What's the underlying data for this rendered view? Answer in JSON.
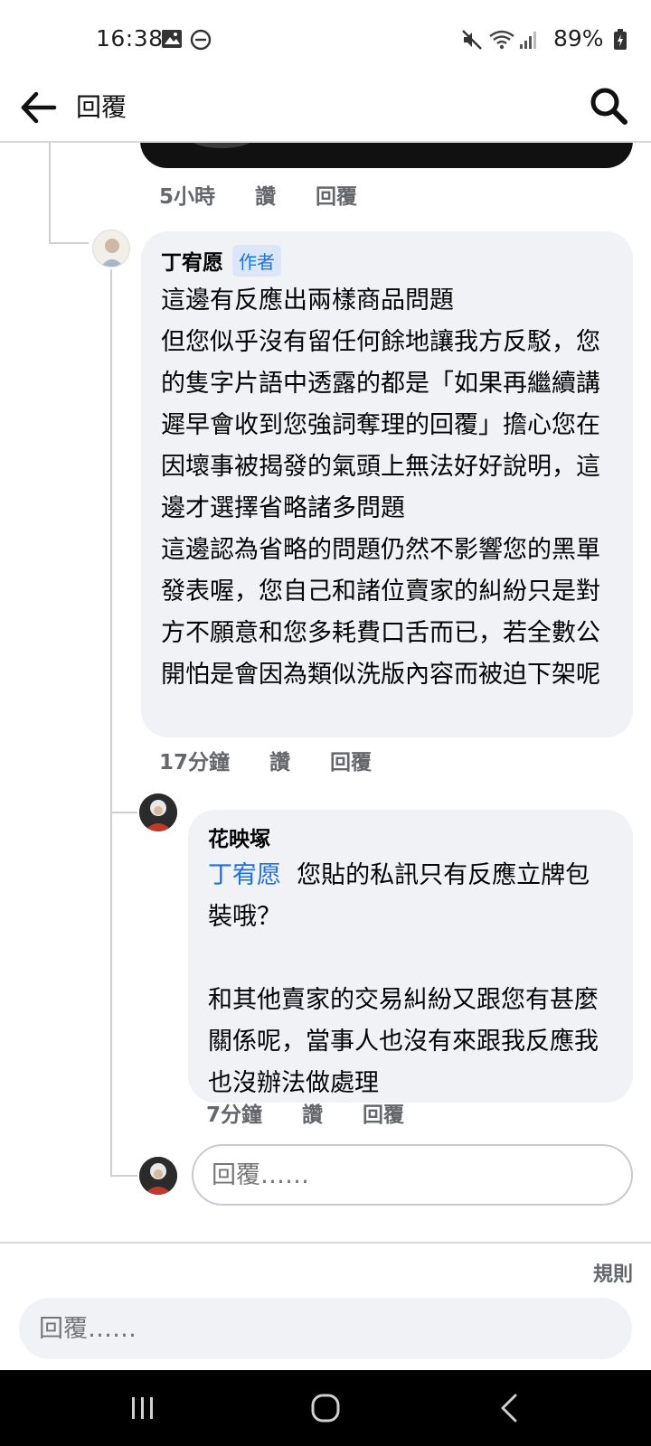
{
  "status": {
    "time": "16:38",
    "battery": "89%"
  },
  "appbar": {
    "title": "回覆"
  },
  "thread": {
    "prev_meta": {
      "time": "5小時",
      "like": "讚",
      "reply": "回覆"
    },
    "comment1": {
      "author": "丁宥愿",
      "badge": "作者",
      "text": "這邊有反應出兩樣商品問題\n但您似乎沒有留任何餘地讓我方反駁，您的隻字片語中透露的都是「如果再繼續講遲早會收到您強詞奪理的回覆」擔心您在因壞事被揭發的氣頭上無法好好說明，這邊才選擇省略諸多問題\n這邊認為省略的問題仍然不影響您的黑單發表喔，您自己和諸位賣家的糾紛只是對方不願意和您多耗費口舌而已，若全數公開怕是會因為類似洗版內容而被迫下架呢",
      "meta": {
        "time": "17分鐘",
        "like": "讚",
        "reply": "回覆"
      }
    },
    "comment2": {
      "author": "花映塚",
      "mention": "丁宥愿",
      "text": "  您貼的私訊只有反應立牌包裝哦？\n\n和其他賣家的交易糾紛又跟您有甚麼關係呢，當事人也沒有來跟我反應我也沒辦法做處理",
      "meta": {
        "time": "7分鐘",
        "like": "讚",
        "reply": "回覆"
      }
    },
    "inline_reply": {
      "placeholder": "回覆……"
    }
  },
  "composer": {
    "rules": "規則",
    "placeholder": "回覆……"
  },
  "icons": {
    "gallery": "image-icon",
    "dnd": "do-not-disturb-icon",
    "mute": "mute-icon",
    "wifi": "wifi-icon",
    "signal": "signal-icon",
    "battery": "battery-icon",
    "back": "arrow-left-icon",
    "search": "search-icon"
  }
}
